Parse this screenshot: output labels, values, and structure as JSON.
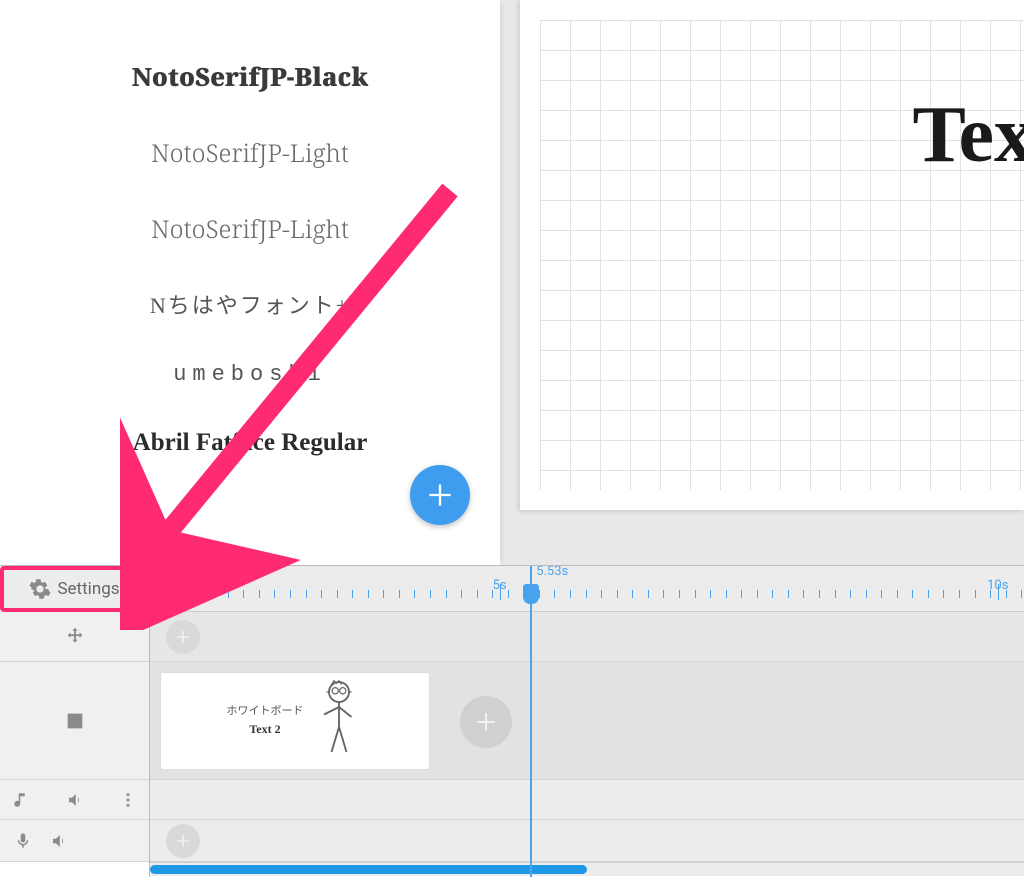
{
  "font_panel": {
    "items": [
      {
        "label": "NotoSerifJP-Black",
        "style": "black"
      },
      {
        "label": "NotoSerifJP-Light",
        "style": "light"
      },
      {
        "label": "NotoSerifJP-Light",
        "style": "light"
      },
      {
        "label": "Nちはやフォント+",
        "style": "hand"
      },
      {
        "label": "umeboshi",
        "style": "mono"
      },
      {
        "label": "Abril Fatface Regular",
        "style": "fat"
      }
    ]
  },
  "canvas": {
    "text_sample": "Tex"
  },
  "timeline": {
    "settings_label": "Settings",
    "playhead_time": "5.53s",
    "ruler_majors": [
      {
        "label": "5s",
        "pos_pct": 40
      },
      {
        "label": "10s",
        "pos_pct": 97
      }
    ],
    "scene_clip": {
      "line1": "ホワイトボード",
      "line2": "Text 2"
    },
    "progress_pct": 50,
    "playhead_pct": 43.5
  },
  "colors": {
    "accent_blue": "#3f9df0",
    "annotation_pink": "#ff2a74"
  }
}
